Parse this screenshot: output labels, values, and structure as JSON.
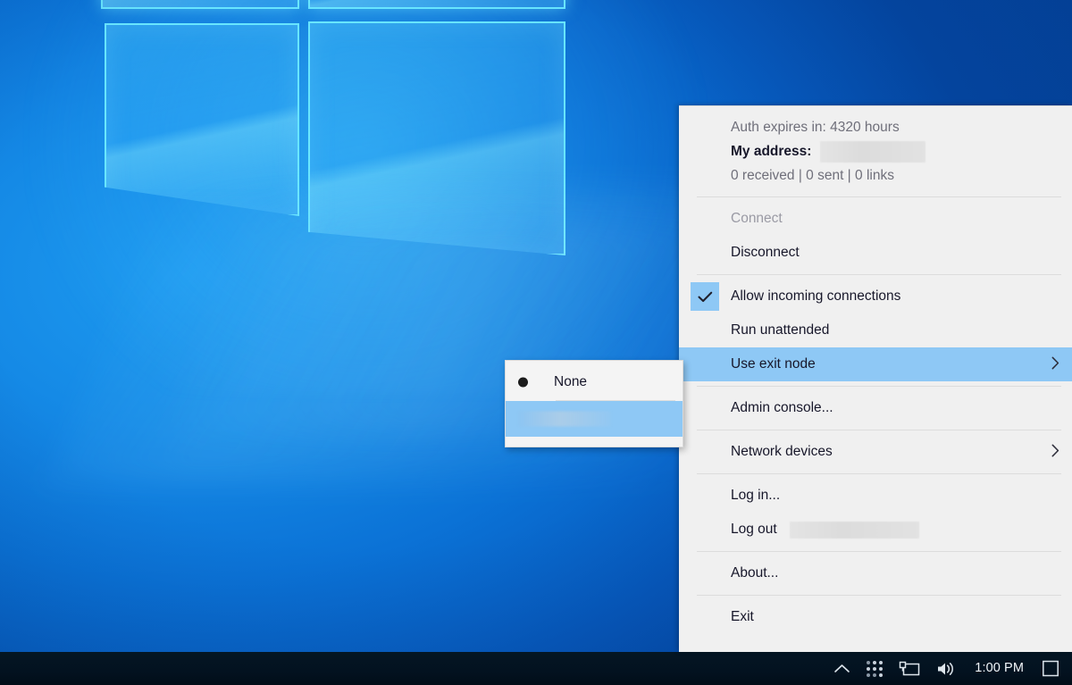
{
  "desktop": {
    "wallpaper_name": "windows-blue-logo-wallpaper"
  },
  "tray_menu": {
    "header": {
      "auth_expiry": "Auth expires in: 4320 hours",
      "address_label": "My address:",
      "address_value_redacted": "",
      "stats": "0 received  |  0 sent  |  0 links"
    },
    "items": [
      {
        "label": "Connect",
        "state": "disabled"
      },
      {
        "label": "Disconnect",
        "state": "normal"
      },
      {
        "label": "Allow incoming connections",
        "state": "checked"
      },
      {
        "label": "Run unattended",
        "state": "normal"
      },
      {
        "label": "Use exit node",
        "state": "highlighted",
        "submenu": true
      },
      {
        "label": "Admin console...",
        "state": "normal"
      },
      {
        "label": "Network devices",
        "state": "normal",
        "submenu": true
      },
      {
        "label": "Log in...",
        "state": "normal"
      },
      {
        "label": "Log out",
        "state": "normal",
        "redacted_suffix": ""
      },
      {
        "label": "About...",
        "state": "normal"
      },
      {
        "label": "Exit",
        "state": "normal"
      }
    ],
    "submenu": {
      "title": "Use exit node",
      "items": [
        {
          "label": "None",
          "selected": true,
          "redacted": false
        },
        {
          "label": "",
          "selected": false,
          "redacted": true,
          "highlighted": true
        }
      ]
    },
    "colors": {
      "menu_background": "#f0f0f0",
      "highlight": "#8ec8f5",
      "text": "#17172a",
      "muted_text": "#6f6f7a",
      "disabled_text": "#9a9aa4",
      "separator": "#dcdcdc"
    }
  },
  "taskbar": {
    "time": "1:00 PM",
    "icons": [
      {
        "name": "show-hidden-icons-chevron-up",
        "glyph": "chevron-up"
      },
      {
        "name": "tray-dots-icon",
        "glyph": "dot-grid"
      },
      {
        "name": "network-icon",
        "glyph": "monitor"
      },
      {
        "name": "volume-icon",
        "glyph": "speaker"
      },
      {
        "name": "action-center-icon",
        "glyph": "square"
      }
    ],
    "background_color": "#031220"
  }
}
